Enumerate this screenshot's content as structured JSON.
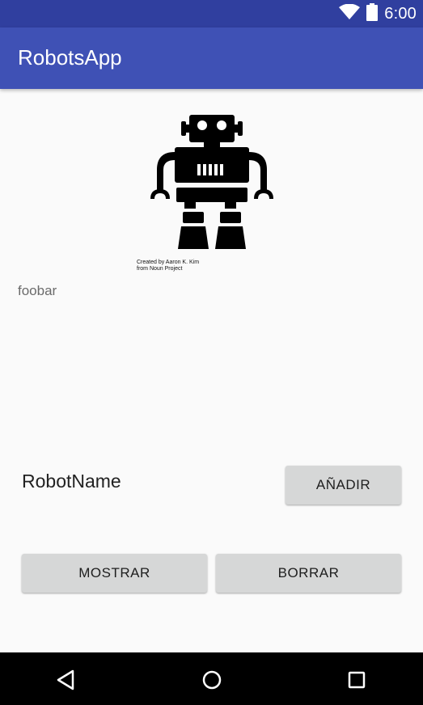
{
  "status_bar": {
    "time": "6:00",
    "icons": [
      "wifi-icon",
      "battery-icon"
    ]
  },
  "app_bar": {
    "title": "RobotsApp",
    "color": "#3f51b5",
    "status_color": "#303f9f"
  },
  "robot_image": {
    "icon": "robot-icon",
    "credit_line1": "Created by Aaron K. Kim",
    "credit_line2": "from Noun Project"
  },
  "content": {
    "foobar_text": "foobar",
    "robot_name_label": "RobotName"
  },
  "buttons": {
    "add": "AÑADIR",
    "show": "MOSTRAR",
    "delete": "BORRAR"
  },
  "nav_bar": {
    "items": [
      "back-icon",
      "home-icon",
      "recents-icon"
    ]
  }
}
